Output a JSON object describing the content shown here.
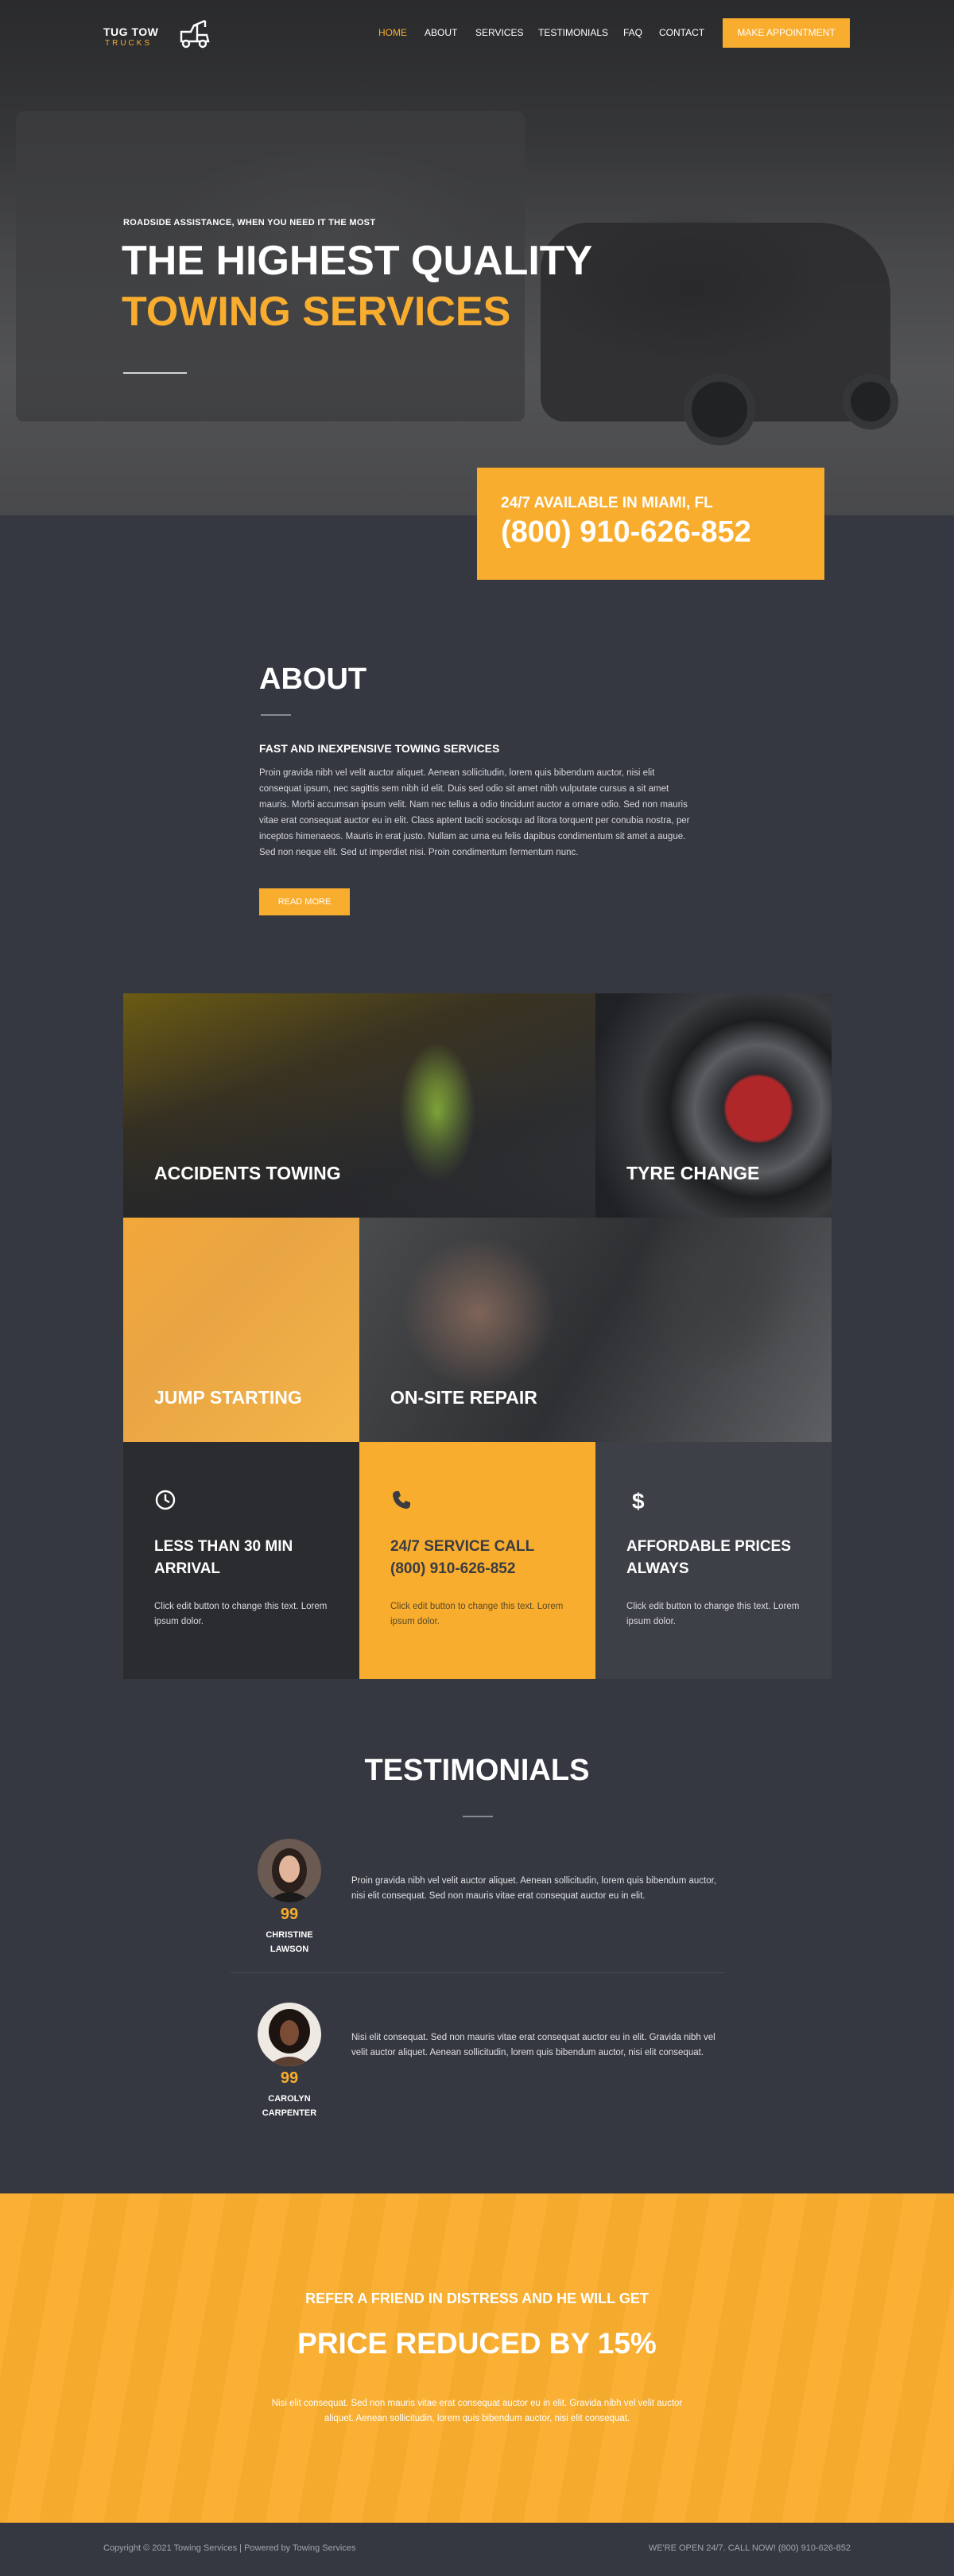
{
  "brand": {
    "name": "TUG TOW",
    "tagline": "TRUCKS",
    "accent": "#f9ad2e",
    "dark": "#353840"
  },
  "nav": {
    "items": [
      "HOME",
      "ABOUT",
      "SERVICES",
      "TESTIMONIALS",
      "FAQ",
      "CONTACT"
    ],
    "active": "HOME",
    "cta": "MAKE APPOINTMENT"
  },
  "hero": {
    "kicker": "ROADSIDE ASSISTANCE, WHEN YOU NEED IT THE MOST",
    "title_line1": "THE HIGHEST QUALITY",
    "title_line2": "TOWING SERVICES",
    "phone_label": "24/7 AVAILABLE IN MIAMI, FL",
    "phone_number": "(800) 910-626-852"
  },
  "about": {
    "title": "ABOUT",
    "subtitle": "FAST AND INEXPENSIVE TOWING SERVICES",
    "body": "Proin gravida nibh vel velit auctor aliquet. Aenean sollicitudin, lorem quis bibendum auctor, nisi elit consequat ipsum, nec sagittis sem nibh id elit.  Duis sed odio sit amet nibh vulputate cursus a sit amet mauris.  Morbi accumsan ipsum velit.  Nam nec tellus a odio tincidunt auctor a ornare odio. Sed non mauris vitae erat consequat auctor eu in elit. Class aptent taciti sociosqu ad litora torquent per conubia nostra, per inceptos himenaeos.  Mauris in erat justo.  Nullam ac urna eu felis dapibus condimentum sit amet a augue. Sed non neque elit. Sed ut imperdiet nisi.  Proin condimentum fermentum nunc.",
    "button": "READ MORE"
  },
  "services": [
    {
      "label": "ACCIDENTS TOWING"
    },
    {
      "label": "TYRE CHANGE"
    },
    {
      "label": "JUMP STARTING"
    },
    {
      "label": "ON-SITE REPAIR"
    }
  ],
  "features": [
    {
      "icon": "clock-icon",
      "title_line1": "LESS THAN 30 MIN",
      "title_line2": "ARRIVAL",
      "text": "Click edit button to change this text. Lorem ipsum dolor."
    },
    {
      "icon": "phone-icon",
      "title_line1": "24/7 SERVICE CALL",
      "title_line2": "(800) 910-626-852",
      "text": "Click edit button to change this text. Lorem ipsum dolor."
    },
    {
      "icon": "dollar-icon",
      "title_line1": "AFFORDABLE PRICES",
      "title_line2": "ALWAYS",
      "text": "Click edit button to change this text. Lorem ipsum dolor."
    }
  ],
  "testimonials": {
    "title": "TESTIMONIALS",
    "items": [
      {
        "name_line1": "CHRISTINE",
        "name_line2": "LAWSON",
        "quote_mark": "99",
        "text": "Proin gravida nibh vel velit auctor aliquet. Aenean sollicitudin, lorem quis bibendum auctor, nisi elit consequat. Sed non  mauris vitae erat consequat auctor eu in elit."
      },
      {
        "name_line1": "CAROLYN",
        "name_line2": "CARPENTER",
        "quote_mark": "99",
        "text": "Nisi elit consequat. Sed non  mauris vitae erat consequat auctor eu in elit. Gravida nibh vel velit auctor aliquet. Aenean sollicitudin, lorem quis bibendum auctor, nisi elit consequat."
      }
    ]
  },
  "promo": {
    "subtitle": "REFER A FRIEND IN DISTRESS AND HE WILL GET",
    "title": "PRICE REDUCED BY 15%",
    "text": "Nisi elit consequat. Sed non mauris vitae erat consequat auctor eu in elit. Gravida nibh vel velit auctor aliquet. Aenean sollicitudin, lorem quis bibendum auctor, nisi elit consequat."
  },
  "footer": {
    "left": "Copyright © 2021 Towing Services  |  Powered by Towing Services",
    "right": "WE'RE OPEN 24/7. CALL  NOW! (800) 910-626-852"
  }
}
